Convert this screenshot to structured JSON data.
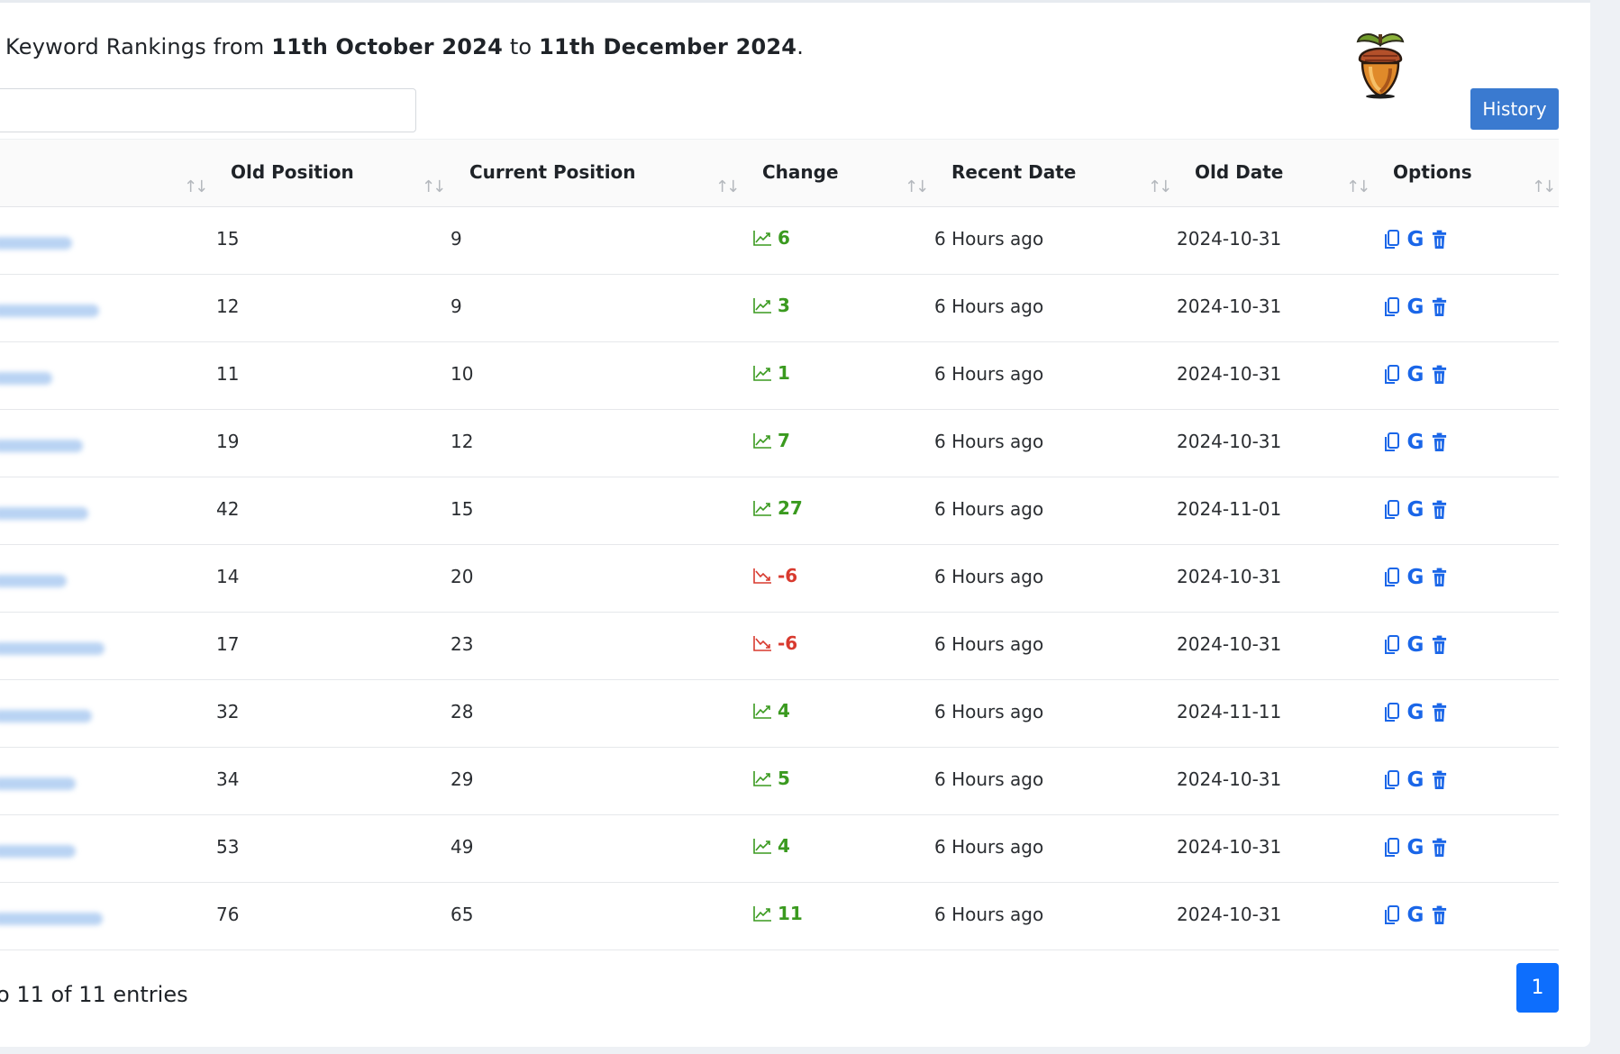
{
  "header": {
    "prefix": "Keyword Rankings from ",
    "start_date": "11th October 2024",
    "connector": " to ",
    "end_date": "11th December 2024",
    "suffix": ".",
    "history_label": "History"
  },
  "search": {
    "placeholder": ""
  },
  "columns": [
    "Old Position",
    "Current Position",
    "Change",
    "Recent Date",
    "Old Date",
    "Options"
  ],
  "colors": {
    "up": "#3a9a1f",
    "down": "#d83a2f",
    "accent": "#1a66e8",
    "button": "#3a7ad0",
    "page": "#0d6efd"
  },
  "rows": [
    {
      "old": "15",
      "current": "9",
      "change": "6",
      "dir": "up",
      "recent": "6 Hours ago",
      "old_date": "2024-10-31"
    },
    {
      "old": "12",
      "current": "9",
      "change": "3",
      "dir": "up",
      "recent": "6 Hours ago",
      "old_date": "2024-10-31"
    },
    {
      "old": "11",
      "current": "10",
      "change": "1",
      "dir": "up",
      "recent": "6 Hours ago",
      "old_date": "2024-10-31"
    },
    {
      "old": "19",
      "current": "12",
      "change": "7",
      "dir": "up",
      "recent": "6 Hours ago",
      "old_date": "2024-10-31"
    },
    {
      "old": "42",
      "current": "15",
      "change": "27",
      "dir": "up",
      "recent": "6 Hours ago",
      "old_date": "2024-11-01"
    },
    {
      "old": "14",
      "current": "20",
      "change": "-6",
      "dir": "down",
      "recent": "6 Hours ago",
      "old_date": "2024-10-31"
    },
    {
      "old": "17",
      "current": "23",
      "change": "-6",
      "dir": "down",
      "recent": "6 Hours ago",
      "old_date": "2024-10-31"
    },
    {
      "old": "32",
      "current": "28",
      "change": "4",
      "dir": "up",
      "recent": "6 Hours ago",
      "old_date": "2024-11-11"
    },
    {
      "old": "34",
      "current": "29",
      "change": "5",
      "dir": "up",
      "recent": "6 Hours ago",
      "old_date": "2024-10-31"
    },
    {
      "old": "53",
      "current": "49",
      "change": "4",
      "dir": "up",
      "recent": "6 Hours ago",
      "old_date": "2024-10-31"
    },
    {
      "old": "76",
      "current": "65",
      "change": "11",
      "dir": "up",
      "recent": "6 Hours ago",
      "old_date": "2024-10-31"
    }
  ],
  "option_icons": [
    "copy-icon",
    "google-icon",
    "trash-icon"
  ],
  "google_letter": "G",
  "footer": {
    "info": "o 11 of 11 entries",
    "page": "1"
  }
}
